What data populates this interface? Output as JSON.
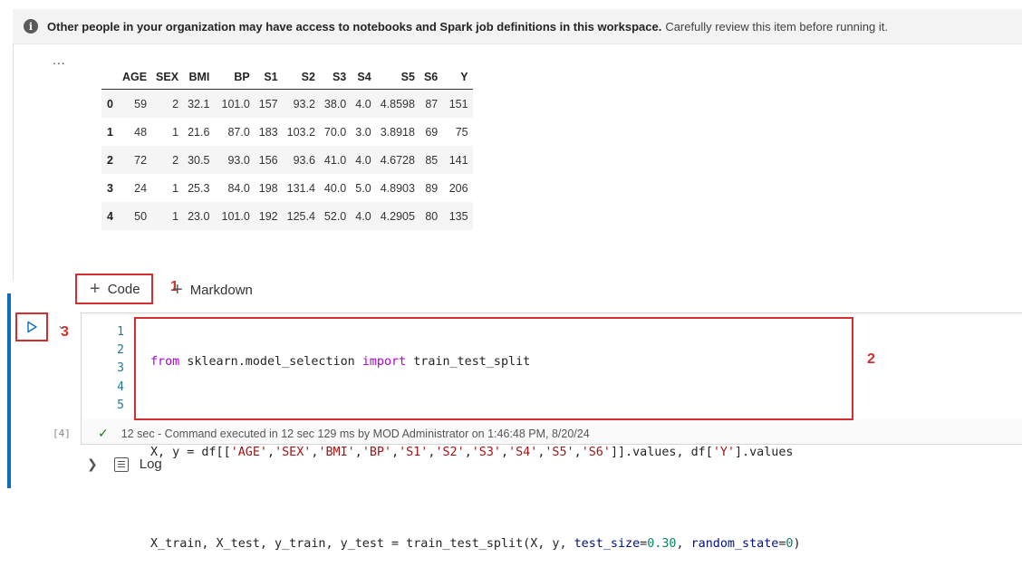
{
  "banner": {
    "bold_text": "Other people in your organization may have access to notebooks and Spark job definitions in this workspace.",
    "rest_text": "Carefully review this item before running it.",
    "icon": "info-icon"
  },
  "output": {
    "ellipsis": "...",
    "columns": [
      "",
      "AGE",
      "SEX",
      "BMI",
      "BP",
      "S1",
      "S2",
      "S3",
      "S4",
      "S5",
      "S6",
      "Y"
    ],
    "rows": [
      [
        "0",
        "59",
        "2",
        "32.1",
        "101.0",
        "157",
        "93.2",
        "38.0",
        "4.0",
        "4.8598",
        "87",
        "151"
      ],
      [
        "1",
        "48",
        "1",
        "21.6",
        "87.0",
        "183",
        "103.2",
        "70.0",
        "3.0",
        "3.8918",
        "69",
        "75"
      ],
      [
        "2",
        "72",
        "2",
        "30.5",
        "93.0",
        "156",
        "93.6",
        "41.0",
        "4.0",
        "4.6728",
        "85",
        "141"
      ],
      [
        "3",
        "24",
        "1",
        "25.3",
        "84.0",
        "198",
        "131.4",
        "40.0",
        "5.0",
        "4.8903",
        "89",
        "206"
      ],
      [
        "4",
        "50",
        "1",
        "23.0",
        "101.0",
        "192",
        "125.4",
        "52.0",
        "4.0",
        "4.2905",
        "80",
        "135"
      ]
    ]
  },
  "toolbar": {
    "add_code_label": "Code",
    "add_markdown_label": "Markdown"
  },
  "annotations": {
    "one": "1",
    "two": "2",
    "three": "3"
  },
  "cell": {
    "line_numbers": [
      "1",
      "2",
      "3",
      "4",
      "5"
    ],
    "exec_count": "[4]",
    "status_text": "12 sec - Command executed in 12 sec 129 ms by MOD Administrator on 1:46:48 PM, 8/20/24"
  },
  "log": {
    "label": "Log"
  },
  "colors": {
    "accent_blue": "#0f6cbd",
    "annotation_red": "#d32f2f",
    "success_green": "#107c10"
  }
}
